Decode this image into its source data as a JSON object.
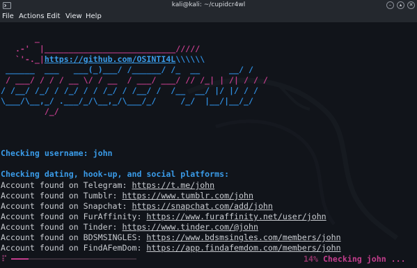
{
  "window": {
    "title": "kali@kali: ~/cupidcr4wl"
  },
  "menubar": {
    "items": [
      "File",
      "Actions",
      "Edit",
      "View",
      "Help"
    ]
  },
  "banner": {
    "lines": [
      "       _",
      "   .-'  |___________________________/////",
      "   `'-._|",
      " ______  ___   ___(_)___/ /______/ /_  __      __/ /",
      " / ___/ / / / __ \\/ / __  / ___/ ___/ // /_| | /| / / /",
      "/ /__/ /_/ / /_/ / / /_/ / /__/ /  /__  __/ |/ |/ / /",
      "\\___/\\__,_/ .___/_/\\__,_/\\___/_/     /_/  |__/|__/_/",
      "         /_/"
    ],
    "url": "https://github.com/OSINTI4L",
    "url_tail": "\\\\\\\\\\\\"
  },
  "output": {
    "checking_username": "Checking username: john",
    "category": "Checking dating, hook-up, and social platforms:",
    "results": [
      {
        "prefix": "Account found on Telegram: ",
        "url": "https://t.me/john"
      },
      {
        "prefix": "Account found on Tumblr: ",
        "url": "https://www.tumblr.com/john"
      },
      {
        "prefix": "Account found on Snapchat: ",
        "url": "https://snapchat.com/add/john"
      },
      {
        "prefix": "Account found on FurAffinity: ",
        "url": "https://www.furaffinity.net/user/john"
      },
      {
        "prefix": "Account found on Tinder: ",
        "url": "https://www.tinder.com/@john"
      },
      {
        "prefix": "Account found on BDSMSINGLES: ",
        "url": "https://www.bdsmsingles.com/members/john"
      },
      {
        "prefix": "Account found on FindAFemDom: ",
        "url": "https://app.findafemdom.com/members/john"
      }
    ]
  },
  "progress": {
    "percent": 14,
    "percent_label": "14%",
    "status_label": "Checking john ...",
    "color": "#c33d8c"
  },
  "colors": {
    "accent_blue": "#2f8ee0",
    "accent_pink": "#c33d8c",
    "background": "#11141a"
  }
}
